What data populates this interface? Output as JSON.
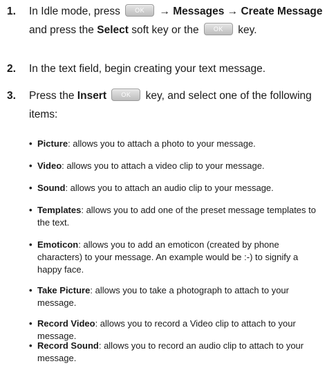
{
  "steps": [
    {
      "number": "1.",
      "t1": "In Idle mode, press",
      "key1": "OK",
      "t2": "→ Messages → Create Message",
      "t3": "and press the",
      "t4": "Select",
      "t5": "soft key or the",
      "key2": "OK",
      "t6": "key."
    },
    {
      "number": "2.",
      "text": "In the text field, begin creating your text message."
    },
    {
      "number": "3.",
      "t1": "Press the",
      "t2": "Insert",
      "key": "OK",
      "t3": "key, and select one of the following items:"
    }
  ],
  "items": [
    {
      "term": "Picture",
      "desc": ": allows you to attach a photo to your message."
    },
    {
      "term": "Video",
      "desc": ": allows you to attach a video clip to your message."
    },
    {
      "term": "Sound",
      "desc": ": allows you to attach an audio clip to your message."
    },
    {
      "term": "Templates",
      "desc": ": allows you to add one of the preset message templates to the text."
    },
    {
      "term": "Emoticon",
      "desc": ": allows you to add an emoticon (created by phone characters) to your message. An example would be :-) to signify a happy face."
    },
    {
      "term": "Take Picture",
      "desc": ": allows you to take a photograph to attach to your message."
    },
    {
      "term": "Record Video",
      "desc": ": allows you to record a Video clip to attach to your message."
    },
    {
      "term": "Record Sound",
      "desc": ": allows you to record an audio clip to attach to your message."
    }
  ],
  "bullet_glyph": "•"
}
